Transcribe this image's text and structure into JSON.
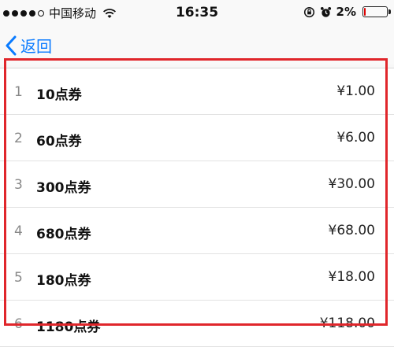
{
  "status_bar": {
    "carrier": "中国移动",
    "time": "16:35",
    "battery_percent": "2%",
    "battery_level": 0.02,
    "icons": [
      "signal-dots",
      "wifi-icon",
      "rotation-lock-icon",
      "alarm-icon",
      "battery-icon"
    ]
  },
  "nav": {
    "back_label": "返回",
    "accent_color": "#0a7bff"
  },
  "list": {
    "highlight_color": "#e0262b",
    "items": [
      {
        "index": "1",
        "name": "10点券",
        "price": "¥1.00"
      },
      {
        "index": "2",
        "name": "60点券",
        "price": "¥6.00"
      },
      {
        "index": "3",
        "name": "300点券",
        "price": "¥30.00"
      },
      {
        "index": "4",
        "name": "680点券",
        "price": "¥68.00"
      },
      {
        "index": "5",
        "name": "180点券",
        "price": "¥18.00"
      },
      {
        "index": "6",
        "name": "1180点券",
        "price": "¥118.00"
      }
    ]
  }
}
